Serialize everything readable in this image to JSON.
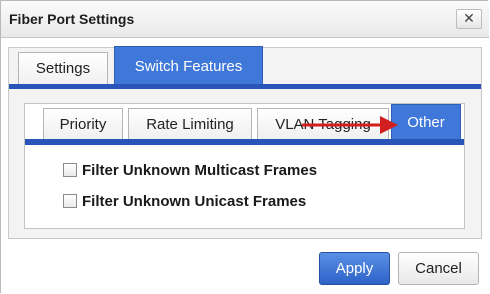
{
  "dialog": {
    "title": "Fiber Port Settings",
    "close_label": "✕"
  },
  "outer_tabs": [
    {
      "label": "Settings",
      "active": false
    },
    {
      "label": "Switch Features",
      "active": true
    }
  ],
  "inner_tabs": [
    {
      "label": "Priority",
      "active": false
    },
    {
      "label": "Rate Limiting",
      "active": false
    },
    {
      "label": "VLAN Tagging",
      "active": false
    },
    {
      "label": "Other",
      "active": true
    }
  ],
  "options": [
    {
      "label": "Filter Unknown Multicast Frames",
      "checked": false
    },
    {
      "label": "Filter Unknown Unicast Frames",
      "checked": false
    }
  ],
  "buttons": {
    "apply": "Apply",
    "cancel": "Cancel"
  },
  "colors": {
    "active_tab": "#3f78d8",
    "tab_bar": "#2a55b8",
    "annotation_arrow": "#d11f1f"
  },
  "icons": {
    "close": "close-icon",
    "annotation": "arrow-right-icon"
  }
}
